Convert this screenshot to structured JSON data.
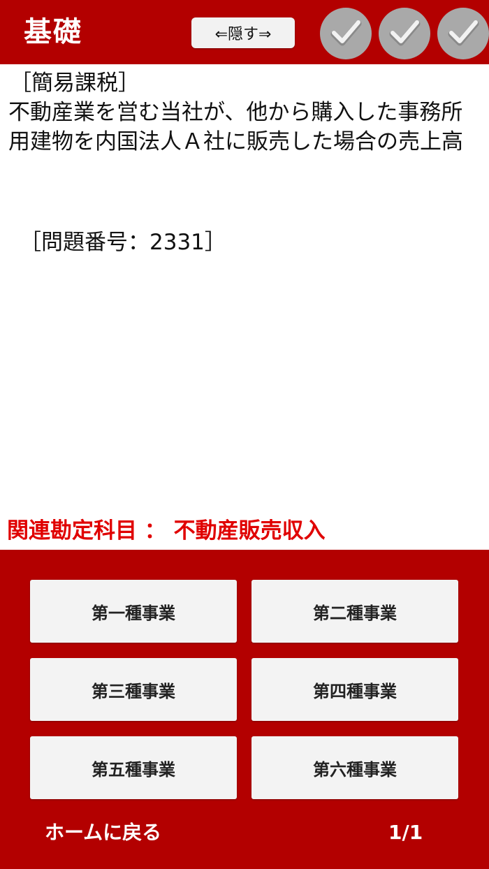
{
  "header": {
    "title": "基礎",
    "hide_label": "⇐隠す⇒",
    "check_icons": [
      "check-icon",
      "check-icon",
      "check-icon"
    ],
    "colors": {
      "background": "#b30000",
      "check_circle": "#a9a9a9"
    }
  },
  "question": {
    "category": "［簡易課税］",
    "text": "不動産業を営む当社が、他から購入した事務所用建物を内国法人Ａ社に販売した場合の売上高",
    "number": "［問題番号：2331］"
  },
  "related": {
    "text": "関連勘定科目 ： 不動産販売収入",
    "color": "#e00000"
  },
  "choices": [
    {
      "label": "第一種事業"
    },
    {
      "label": "第二種事業"
    },
    {
      "label": "第三種事業"
    },
    {
      "label": "第四種事業"
    },
    {
      "label": "第五種事業"
    },
    {
      "label": "第六種事業"
    }
  ],
  "footer": {
    "home_label": "ホームに戻る",
    "page": "1/1"
  }
}
